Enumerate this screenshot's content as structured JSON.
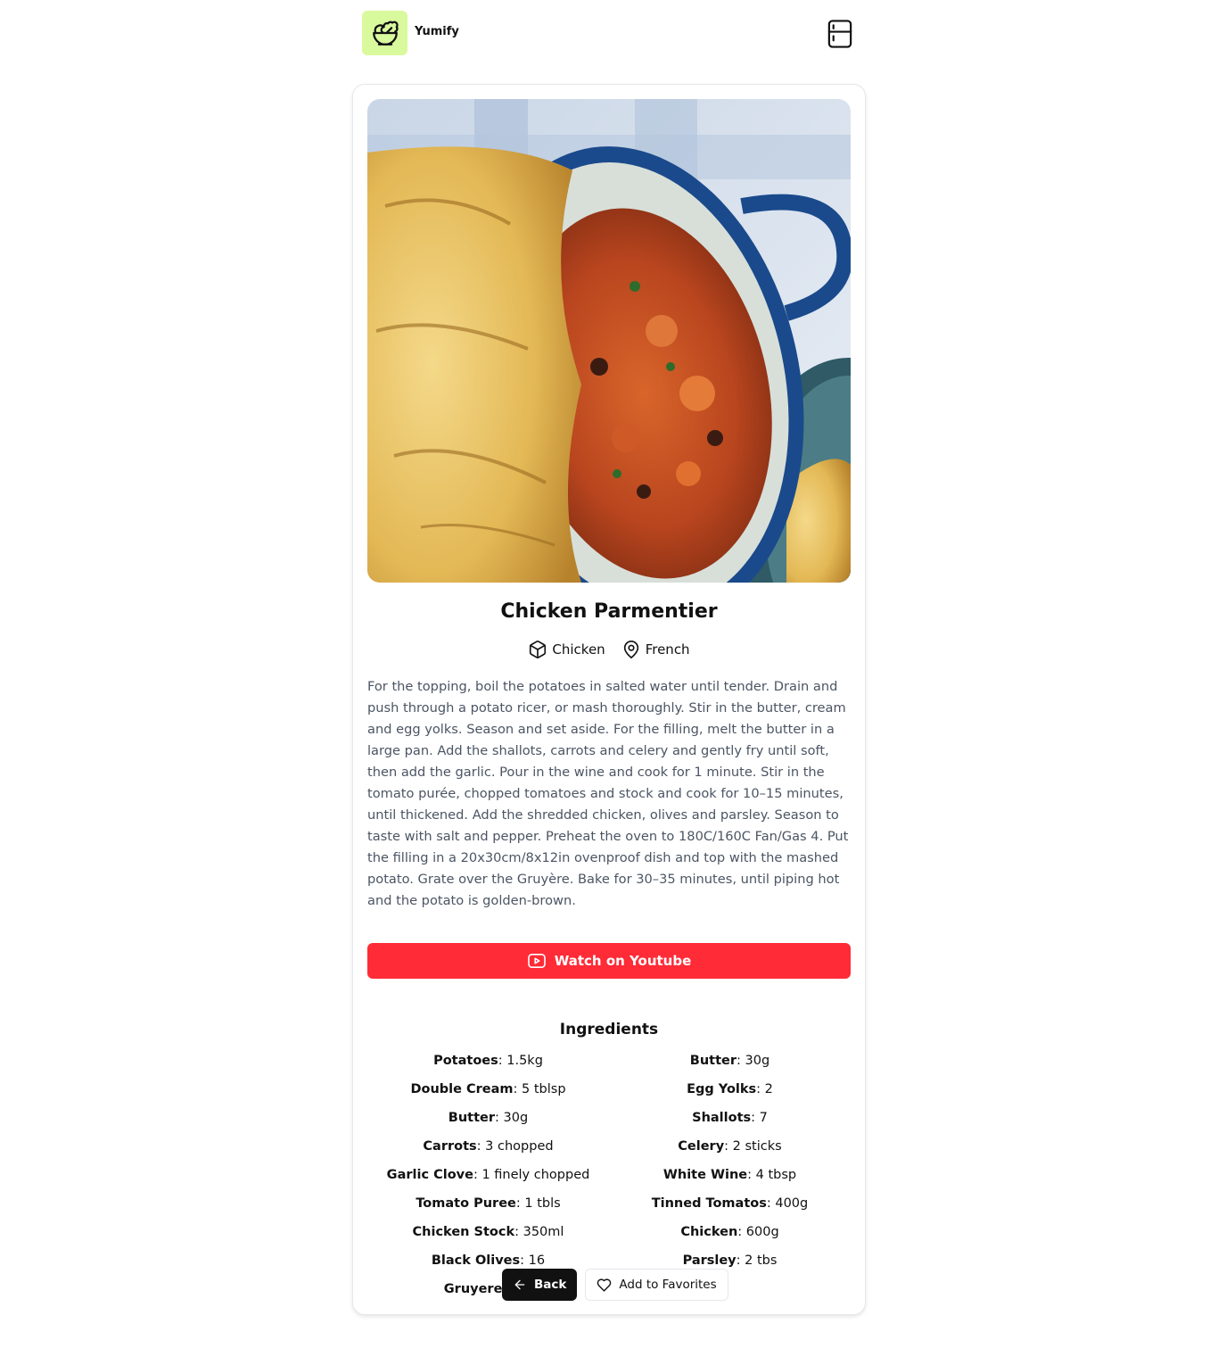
{
  "header": {
    "brand": "Yumify",
    "logo_icon": "salad-bowl-icon",
    "fridge_icon": "fridge-icon",
    "logo_bg": "#d9f99d"
  },
  "recipe": {
    "title": "Chicken Parmentier",
    "category": "Chicken",
    "area": "French",
    "category_icon": "box-icon",
    "area_icon": "map-pin-icon",
    "instructions": "For the topping, boil the potatoes in salted water until tender. Drain and push through a potato ricer, or mash thoroughly. Stir in the butter, cream and egg yolks. Season and set aside. For the filling, melt the butter in a large pan. Add the shallots, carrots and celery and gently fry until soft, then add the garlic. Pour in the wine and cook for 1 minute. Stir in the tomato purée, chopped tomatoes and stock and cook for 10–15 minutes, until thickened. Add the shredded chicken, olives and parsley. Season to taste with salt and pepper. Preheat the oven to 180C/160C Fan/Gas 4. Put the filling in a 20x30cm/8x12in ovenproof dish and top with the mashed potato. Grate over the Gruyère. Bake for 30–35 minutes, until piping hot and the potato is golden-brown.",
    "youtube_label": "Watch on Youtube",
    "youtube_icon": "youtube-icon",
    "youtube_color": "#ff2b37"
  },
  "ingredients": {
    "title": "Ingredients",
    "items": [
      {
        "name": "Potatoes",
        "measure": "1.5kg"
      },
      {
        "name": "Butter",
        "measure": "30g"
      },
      {
        "name": "Double Cream",
        "measure": "5 tblsp"
      },
      {
        "name": "Egg Yolks",
        "measure": "2"
      },
      {
        "name": "Butter",
        "measure": "30g"
      },
      {
        "name": "Shallots",
        "measure": "7"
      },
      {
        "name": "Carrots",
        "measure": "3 chopped"
      },
      {
        "name": "Celery",
        "measure": "2 sticks"
      },
      {
        "name": "Garlic Clove",
        "measure": "1 finely chopped"
      },
      {
        "name": "White Wine",
        "measure": "4 tbsp"
      },
      {
        "name": "Tomato Puree",
        "measure": "1 tbls"
      },
      {
        "name": "Tinned Tomatos",
        "measure": "400g"
      },
      {
        "name": "Chicken Stock",
        "measure": "350ml"
      },
      {
        "name": "Chicken",
        "measure": "600g"
      },
      {
        "name": "Black Olives",
        "measure": "16"
      },
      {
        "name": "Parsley",
        "measure": "2 tbs"
      },
      {
        "name": "Gruyere che",
        "measure": ""
      }
    ]
  },
  "actions": {
    "back_label": "Back",
    "back_icon": "arrow-left-icon",
    "favorite_label": "Add to Favorites",
    "favorite_icon": "heart-icon"
  }
}
